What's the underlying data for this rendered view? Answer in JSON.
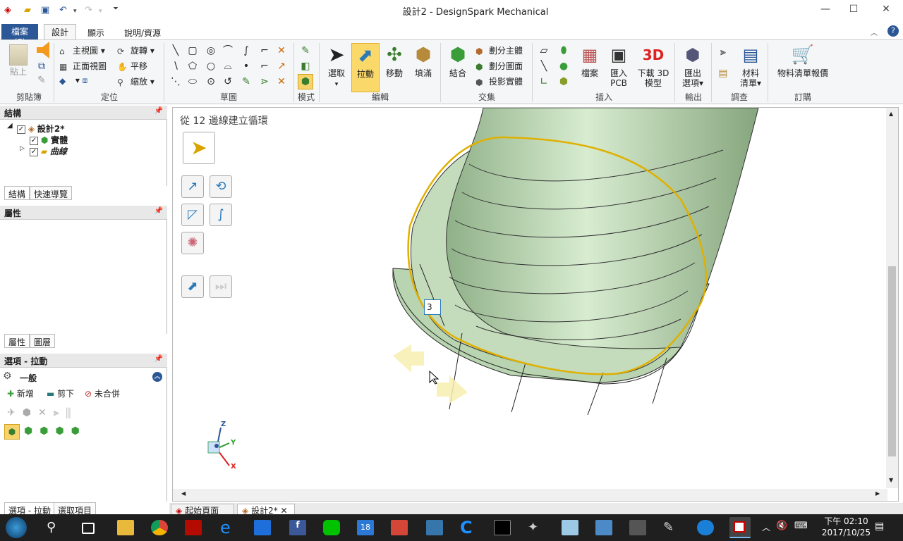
{
  "window": {
    "title": "設計2 - DesignSpark Mechanical"
  },
  "ribbon_tabs": {
    "file": "檔案(F)",
    "design": "設計",
    "display": "顯示",
    "help": "說明/資源"
  },
  "ribbon": {
    "clipboard": {
      "paste": "貼上",
      "label": "剪貼簿"
    },
    "orient": {
      "home": "主視圖",
      "front": "正面視圖",
      "rotate": "旋轉",
      "pan": "平移",
      "zoom": "縮放",
      "label": "定位"
    },
    "sketch": {
      "label": "草圖"
    },
    "mode": {
      "label": "模式"
    },
    "edit": {
      "select": "選取",
      "pull": "拉動",
      "move": "移動",
      "fill": "填滿",
      "label": "編輯"
    },
    "intersect": {
      "combine": "結合",
      "split_body": "劃分主體",
      "split_face": "劃分圖面",
      "project": "投影實體",
      "label": "交集"
    },
    "insert": {
      "file": "檔案",
      "import_pcb_1": "匯入",
      "import_pcb_2": "PCB",
      "download_1": "下載 3D",
      "download_2": "模型",
      "label": "插入"
    },
    "output": {
      "export_1": "匯出",
      "export_2": "選項",
      "label": "輸出"
    },
    "inspect": {
      "bom_1": "材料",
      "bom_2": "清單",
      "label": "調查"
    },
    "order": {
      "quote": "物料清單報價",
      "label": "訂購"
    }
  },
  "structure": {
    "header": "結構",
    "root": "設計2*",
    "items": [
      "實體",
      "曲線"
    ],
    "tabs": [
      "結構",
      "快速導覽"
    ]
  },
  "properties": {
    "header": "屬性",
    "tabs": [
      "屬性",
      "圖層"
    ]
  },
  "options": {
    "header": "選項 - 拉動",
    "section": "一般",
    "add": "新增",
    "cut": "剪下",
    "no_merge": "未合併",
    "bottom_tabs": [
      "選項 - 拉動",
      "選取項目"
    ]
  },
  "viewport": {
    "caption": "從 12 邊線建立循環",
    "edge_count": "3",
    "axes": {
      "z": "Z",
      "y": "Y",
      "x": "X"
    }
  },
  "doc_tabs": [
    "起始頁面",
    "設計2*"
  ],
  "taskbar": {
    "calendar_day": "18",
    "time": "下午 02:10",
    "date": "2017/10/25"
  }
}
